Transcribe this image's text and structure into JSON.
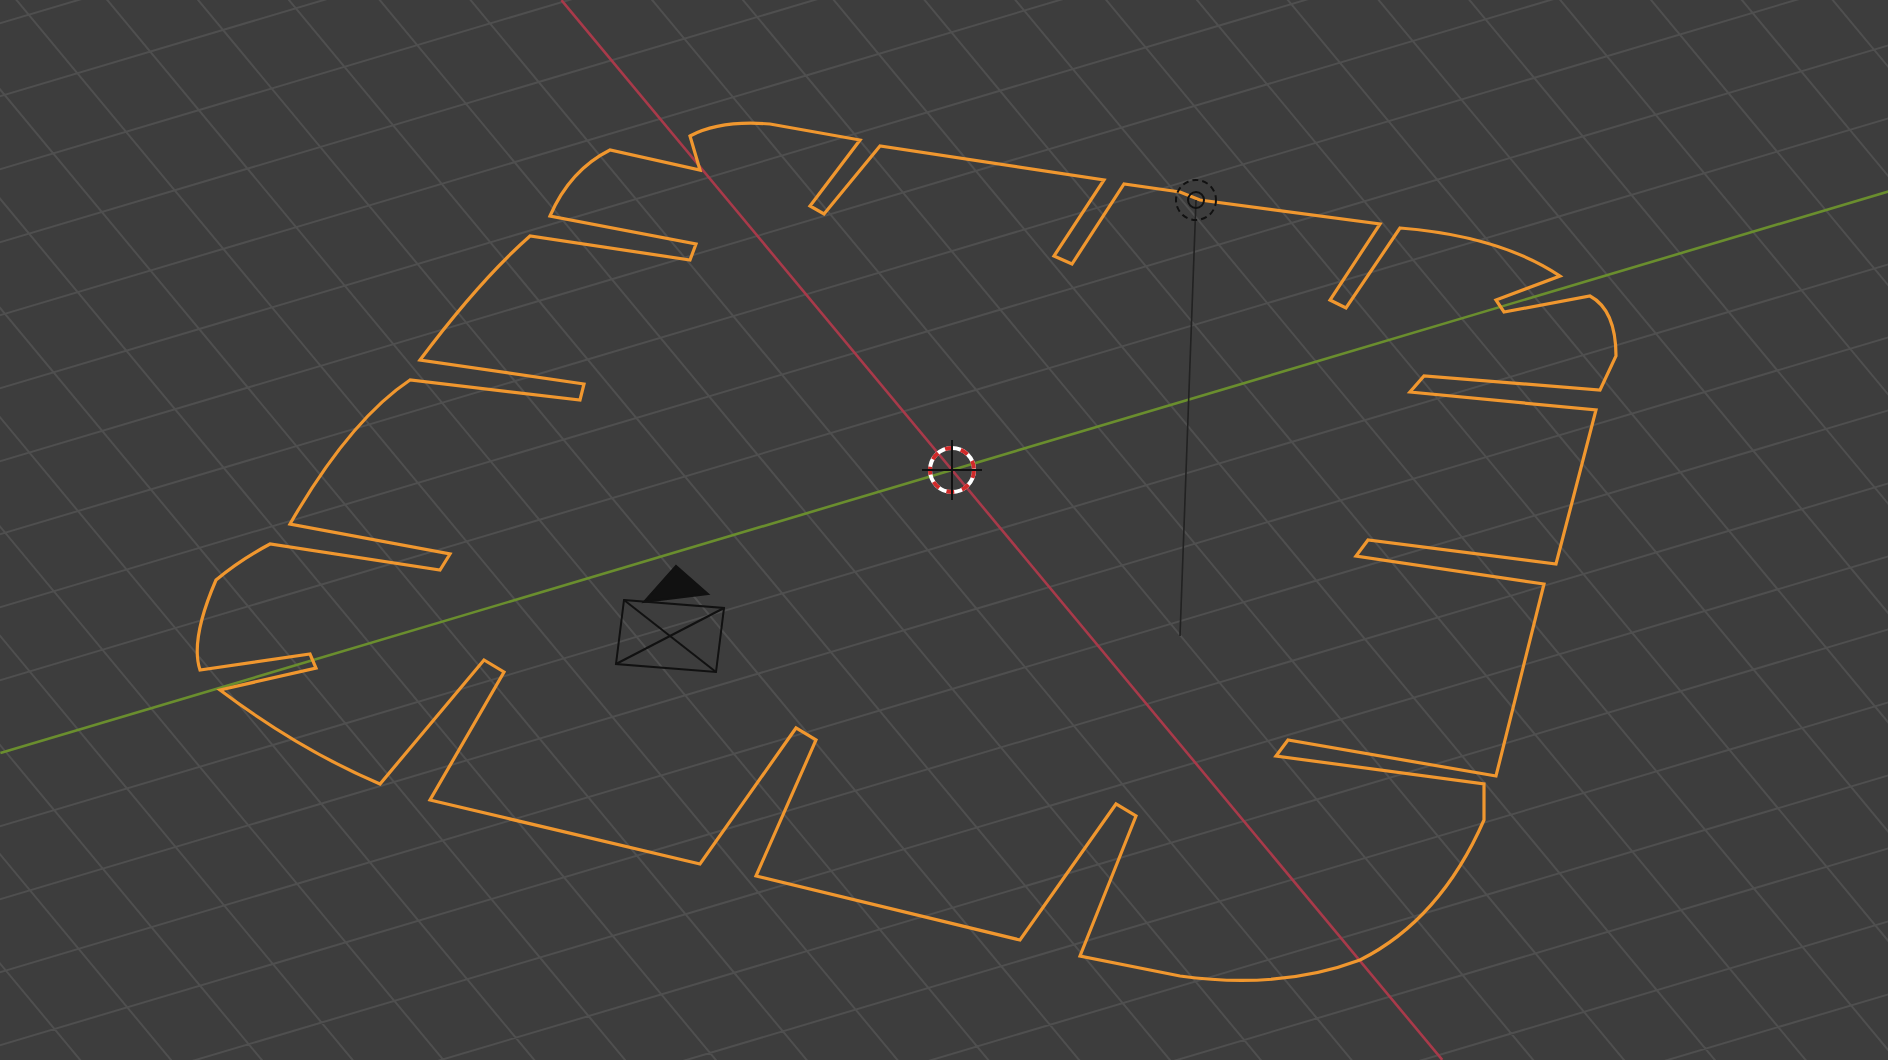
{
  "viewport": {
    "objects": [
      {
        "kind": "mesh",
        "selected": true
      },
      {
        "kind": "light",
        "selected": false
      },
      {
        "kind": "camera",
        "selected": false
      }
    ]
  }
}
